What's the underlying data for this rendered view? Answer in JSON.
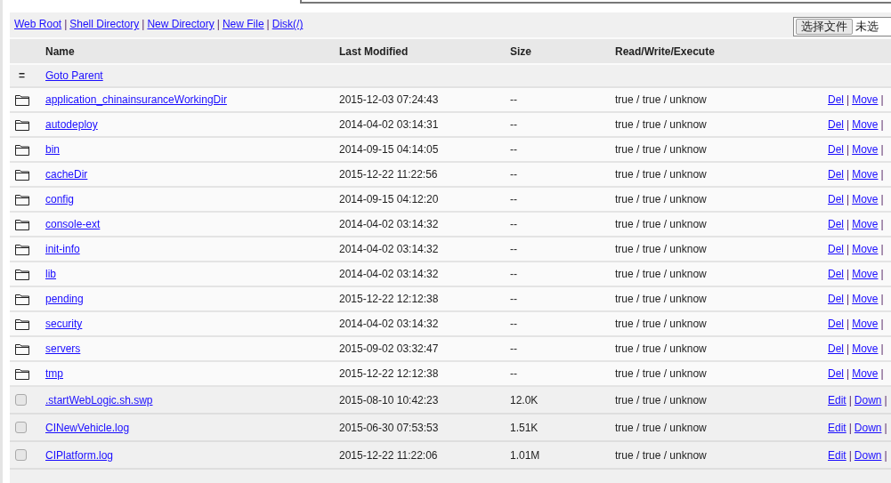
{
  "separator": "|",
  "nav_links": [
    "Web Root",
    "Shell Directory",
    "New Directory",
    "New File",
    "Disk(/)"
  ],
  "upload": {
    "button": "选择文件",
    "status": "未选"
  },
  "table": {
    "columns": [
      "Name",
      "Last Modified",
      "Size",
      "Read/Write/Execute"
    ],
    "parent": {
      "icon": "=",
      "label": "Goto Parent"
    },
    "rows": [
      {
        "kind": "folder",
        "name": "application_chinainsuranceWorkingDir",
        "modified": "2015-12-03 07:24:43",
        "size": "--",
        "rwx": "true / true / unknow",
        "actions": [
          "Del",
          "Move"
        ]
      },
      {
        "kind": "folder",
        "name": "autodeploy",
        "modified": "2014-04-02 03:14:31",
        "size": "--",
        "rwx": "true / true / unknow",
        "actions": [
          "Del",
          "Move"
        ]
      },
      {
        "kind": "folder",
        "name": "bin",
        "modified": "2014-09-15 04:14:05",
        "size": "--",
        "rwx": "true / true / unknow",
        "actions": [
          "Del",
          "Move"
        ]
      },
      {
        "kind": "folder",
        "name": "cacheDir",
        "modified": "2015-12-22 11:22:56",
        "size": "--",
        "rwx": "true / true / unknow",
        "actions": [
          "Del",
          "Move"
        ]
      },
      {
        "kind": "folder",
        "name": "config",
        "modified": "2014-09-15 04:12:20",
        "size": "--",
        "rwx": "true / true / unknow",
        "actions": [
          "Del",
          "Move"
        ]
      },
      {
        "kind": "folder",
        "name": "console-ext",
        "modified": "2014-04-02 03:14:32",
        "size": "--",
        "rwx": "true / true / unknow",
        "actions": [
          "Del",
          "Move"
        ]
      },
      {
        "kind": "folder",
        "name": "init-info",
        "modified": "2014-04-02 03:14:32",
        "size": "--",
        "rwx": "true / true / unknow",
        "actions": [
          "Del",
          "Move"
        ]
      },
      {
        "kind": "folder",
        "name": "lib",
        "modified": "2014-04-02 03:14:32",
        "size": "--",
        "rwx": "true / true / unknow",
        "actions": [
          "Del",
          "Move"
        ]
      },
      {
        "kind": "folder",
        "name": "pending",
        "modified": "2015-12-22 12:12:38",
        "size": "--",
        "rwx": "true / true / unknow",
        "actions": [
          "Del",
          "Move"
        ]
      },
      {
        "kind": "folder",
        "name": "security",
        "modified": "2014-04-02 03:14:32",
        "size": "--",
        "rwx": "true / true / unknow",
        "actions": [
          "Del",
          "Move"
        ]
      },
      {
        "kind": "folder",
        "name": "servers",
        "modified": "2015-09-02 03:32:47",
        "size": "--",
        "rwx": "true / true / unknow",
        "actions": [
          "Del",
          "Move"
        ]
      },
      {
        "kind": "folder",
        "name": "tmp",
        "modified": "2015-12-22 12:12:38",
        "size": "--",
        "rwx": "true / true / unknow",
        "actions": [
          "Del",
          "Move"
        ]
      },
      {
        "kind": "file",
        "checked": false,
        "name": ".startWebLogic.sh.swp",
        "modified": "2015-08-10 10:42:23",
        "size": "12.0K",
        "rwx": "true / true / unknow",
        "actions": [
          "Edit",
          "Down"
        ]
      },
      {
        "kind": "file",
        "checked": false,
        "name": "CINewVehicle.log",
        "modified": "2015-06-30 07:53:53",
        "size": "1.51K",
        "rwx": "true / true / unknow",
        "actions": [
          "Edit",
          "Down"
        ]
      },
      {
        "kind": "file",
        "checked": false,
        "name": "CIPlatform.log",
        "modified": "2015-12-22 11:22:06",
        "size": "1.01M",
        "rwx": "true / true / unknow",
        "actions": [
          "Edit",
          "Down"
        ]
      }
    ]
  }
}
